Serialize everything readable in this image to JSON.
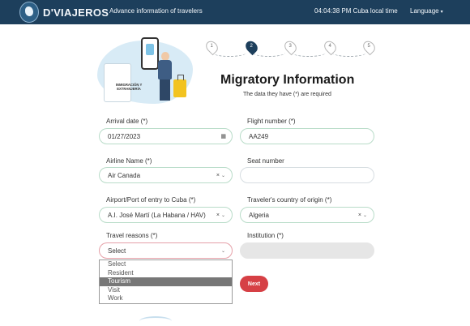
{
  "header": {
    "brand": "D'VIAJEROS",
    "tagline": "Advance information of travelers",
    "clock": "04:04:38 PM Cuba local time",
    "language_label": "Language",
    "language_caret": "▾"
  },
  "hero": {
    "booth_sign": "INMIGRACIÓN Y EXTRANJERÍA"
  },
  "steps": [
    "1",
    "2",
    "3",
    "4",
    "5"
  ],
  "page": {
    "title": "Migratory Information",
    "subtitle": "The data they have (*) are required"
  },
  "form": {
    "arrival_date": {
      "label": "Arrival date (*)",
      "value": "01/27/2023"
    },
    "flight_number": {
      "label": "Flight number (*)",
      "value": "AA249"
    },
    "airline_name": {
      "label": "Airline Name (*)",
      "value": "Air Canada"
    },
    "seat_number": {
      "label": "Seat number",
      "value": ""
    },
    "airport": {
      "label": "Airport/Port of entry to Cuba (*)",
      "value": "A.I. José Martí (La Habana / HAV)"
    },
    "origin_country": {
      "label": "Traveler's country of origin (*)",
      "value": "Algeria"
    },
    "travel_reasons": {
      "label": "Travel reasons (*)",
      "value": "Select"
    },
    "institution": {
      "label": "Institution (*)",
      "value": ""
    },
    "clear_glyph": "×",
    "chevron_glyph": "⌄",
    "calendar_glyph": "▦"
  },
  "dropdown": {
    "options": [
      "Select",
      "Resident",
      "Tourism",
      "Visit",
      "Work"
    ],
    "highlighted": "Tourism"
  },
  "next_button": {
    "label": "Next"
  },
  "colors": {
    "header_bg": "#1d3f5c",
    "next_button": "#d64045",
    "field_border": "#b9dcc9",
    "error_border": "#e5a0a8",
    "highlight_option": "#777777"
  }
}
